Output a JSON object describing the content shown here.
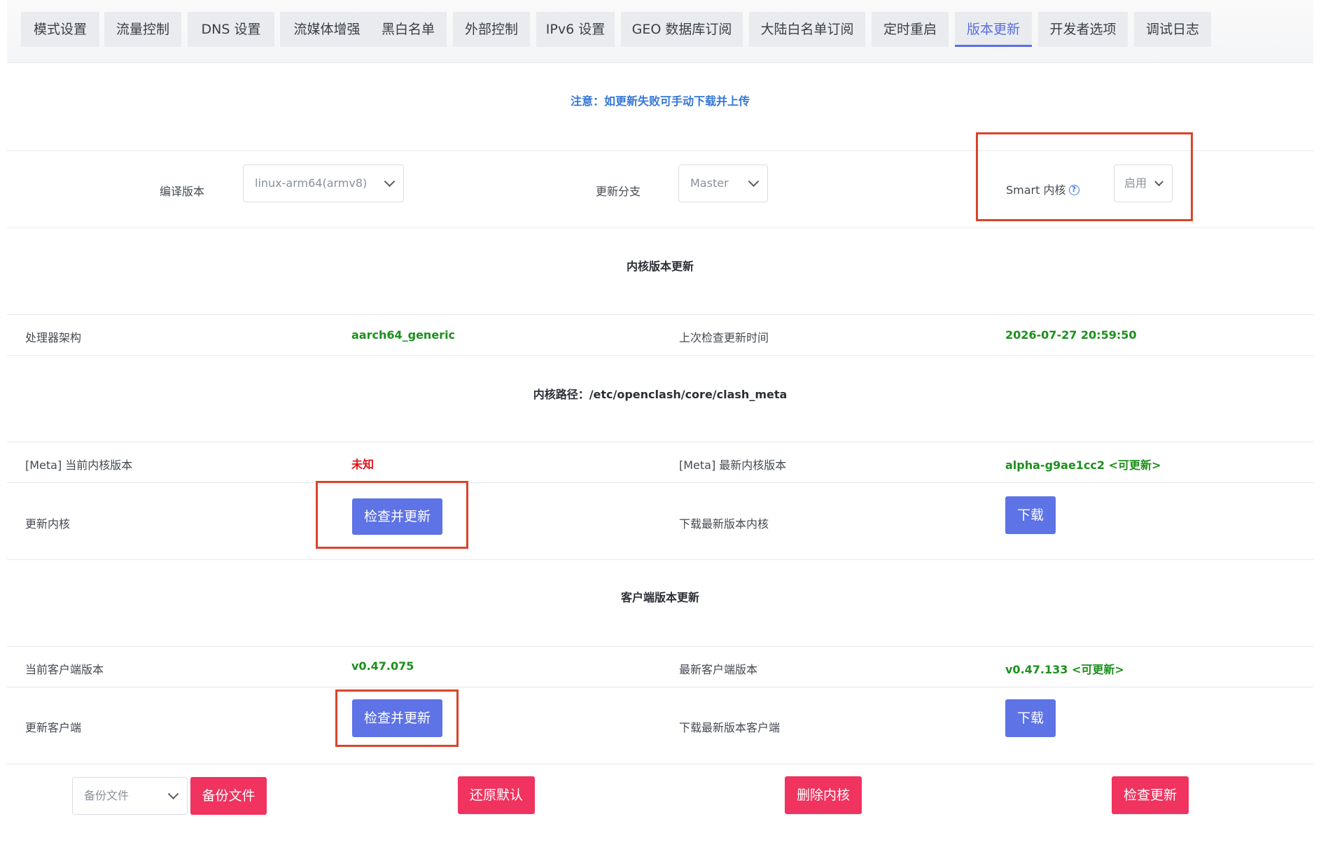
{
  "tabs": [
    {
      "label": "模式设置"
    },
    {
      "label": "流量控制"
    },
    {
      "label": "DNS 设置"
    },
    {
      "label": "流媒体增强"
    },
    {
      "label": "黑白名单"
    },
    {
      "label": "外部控制"
    },
    {
      "label": "IPv6 设置"
    },
    {
      "label": "GEO 数据库订阅"
    },
    {
      "label": "大陆白名单订阅"
    },
    {
      "label": "定时重启"
    },
    {
      "label": "版本更新",
      "active": true
    },
    {
      "label": "开发者选项"
    },
    {
      "label": "调试日志"
    }
  ],
  "notice": "注意：如更新失败可手动下载并上传",
  "config": {
    "compile_label": "编译版本",
    "compile_value": "linux-arm64(armv8)",
    "branch_label": "更新分支",
    "branch_value": "Master",
    "smart_label": "Smart 内核",
    "smart_help_icon": "question-circle-icon",
    "smart_value": "启用"
  },
  "core": {
    "section_title": "内核版本更新",
    "arch_label": "处理器架构",
    "arch_value": "aarch64_generic",
    "last_check_label": "上次检查更新时间",
    "last_check_value": "2026-07-27 20:59:50",
    "path": "内核路径：/etc/openclash/core/clash_meta",
    "current_label": "[Meta] 当前内核版本",
    "current_value": "未知",
    "latest_label": "[Meta] 最新内核版本",
    "latest_value": "alpha-g9ae1cc2 <可更新>",
    "update_label": "更新内核",
    "update_button": "检查并更新",
    "download_label": "下载最新版本内核",
    "download_button": "下载"
  },
  "client": {
    "section_title": "客户端版本更新",
    "current_label": "当前客户端版本",
    "current_value": "v0.47.075",
    "latest_label": "最新客户端版本",
    "latest_value": "v0.47.133 <可更新>",
    "update_label": "更新客户端",
    "update_button": "检查并更新",
    "download_label": "下载最新版本客户端",
    "download_button": "下载"
  },
  "footer": {
    "backup_select": "备份文件",
    "backup_button": "备份文件",
    "restore_button": "还原默认",
    "delete_core_button": "删除内核",
    "check_update_button": "检查更新"
  },
  "colors": {
    "accent": "#5e73e5",
    "danger": "#f0335f",
    "ok": "#1c8f1c",
    "error": "#e0141e",
    "highlight": "#d8452a"
  }
}
